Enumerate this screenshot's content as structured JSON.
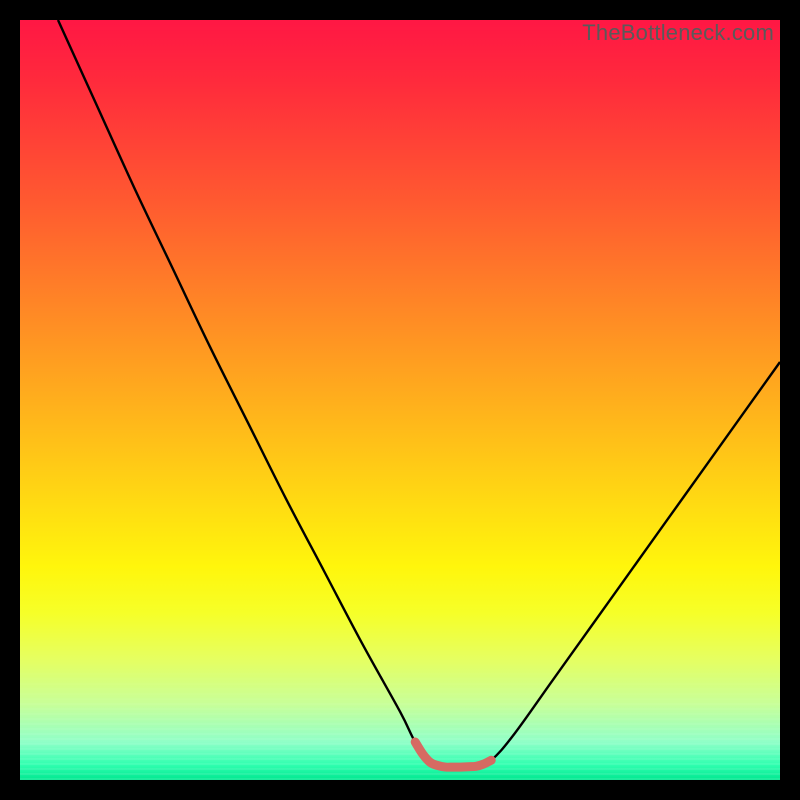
{
  "attribution": "TheBottleneck.com",
  "colors": {
    "frame": "#000000",
    "curve": "#000000",
    "highlight": "#d66a62"
  },
  "chart_data": {
    "type": "line",
    "title": "",
    "xlabel": "",
    "ylabel": "",
    "xlim": [
      0,
      100
    ],
    "ylim": [
      0,
      100
    ],
    "annotations": [],
    "series": [
      {
        "name": "bottleneck-curve",
        "x": [
          5,
          10,
          15,
          20,
          25,
          30,
          35,
          40,
          45,
          50,
          52,
          54,
          56,
          58,
          60,
          62,
          65,
          70,
          75,
          80,
          85,
          90,
          95,
          100
        ],
        "y": [
          100,
          89,
          78,
          67.5,
          57,
          47,
          37,
          27.5,
          18,
          9,
          5,
          2.3,
          1.7,
          1.7,
          1.8,
          2.6,
          6,
          13,
          20,
          27,
          34,
          41,
          48,
          55
        ]
      },
      {
        "name": "optimal-range-highlight",
        "x": [
          52,
          53,
          54,
          55,
          56,
          57,
          58,
          59,
          60,
          61,
          62
        ],
        "y": [
          5,
          3.4,
          2.3,
          1.9,
          1.7,
          1.7,
          1.7,
          1.75,
          1.8,
          2.1,
          2.6
        ]
      }
    ]
  }
}
